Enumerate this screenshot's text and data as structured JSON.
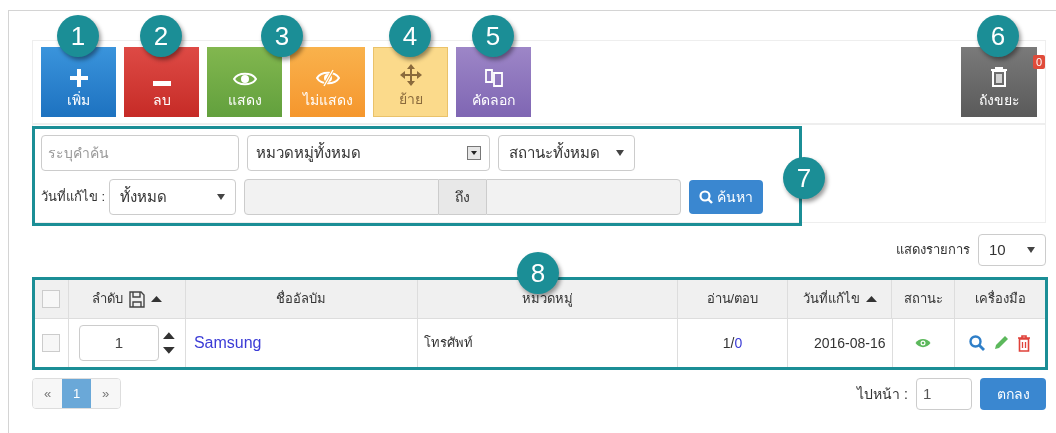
{
  "toolbar": {
    "buttons": [
      {
        "kind": "add",
        "label": "เพิ่ม",
        "callout": "1"
      },
      {
        "kind": "delete",
        "label": "ลบ",
        "callout": "2"
      },
      {
        "kind": "show",
        "label": "แสดง",
        "callout": "3"
      },
      {
        "kind": "hide",
        "label": "ไม่แสดง"
      },
      {
        "kind": "move",
        "label": "ย้าย",
        "callout": "4"
      },
      {
        "kind": "copy",
        "label": "คัดลอก",
        "callout": "5"
      }
    ],
    "trash": {
      "label": "ถังขยะ",
      "count": "0",
      "callout": "6"
    }
  },
  "filters": {
    "callout": "7",
    "keyword": {
      "placeholder": "ระบุคำค้น"
    },
    "category": {
      "value": "หมวดหมู่ทั้งหมด"
    },
    "status": {
      "value": "สถานะทั้งหมด"
    },
    "date_label": "วันที่แก้ไข :",
    "date": {
      "value": "ทั้งหมด"
    },
    "range_separator": "ถึง",
    "search_button": "ค้นหา"
  },
  "page_size": {
    "label": "แสดงรายการ",
    "value": "10"
  },
  "table": {
    "callout": "8",
    "header_checked": false,
    "columns": [
      {
        "label": "ลำดับ",
        "save_icon": true,
        "sort_icon": true
      },
      {
        "label": "ชื่ออัลบัม",
        "save_icon": false,
        "sort_icon": false
      },
      {
        "label": "หมวดหมู่",
        "save_icon": false,
        "sort_icon": false
      },
      {
        "label": "อ่าน/ตอบ",
        "save_icon": false,
        "sort_icon": false
      },
      {
        "label": "วันที่แก้ไข",
        "save_icon": false,
        "sort_icon": true
      },
      {
        "label": "สถานะ",
        "save_icon": false,
        "sort_icon": false
      },
      {
        "label": "เครื่องมือ",
        "save_icon": false,
        "sort_icon": false
      }
    ],
    "rows": [
      {
        "checked": false,
        "order": "1",
        "name": "Samsung",
        "category": "โทรศัพท์",
        "reads": "1",
        "separator": "/",
        "replies": "0",
        "date": "2016-08-16",
        "visible": true
      }
    ]
  },
  "pagination": {
    "pages": [
      {
        "label": "«",
        "selected": false
      },
      {
        "label": "1",
        "selected": true
      },
      {
        "label": "»",
        "selected": false
      }
    ]
  },
  "goto": {
    "label": "ไปหน้า :",
    "value": "1",
    "button": "ตกลง"
  }
}
